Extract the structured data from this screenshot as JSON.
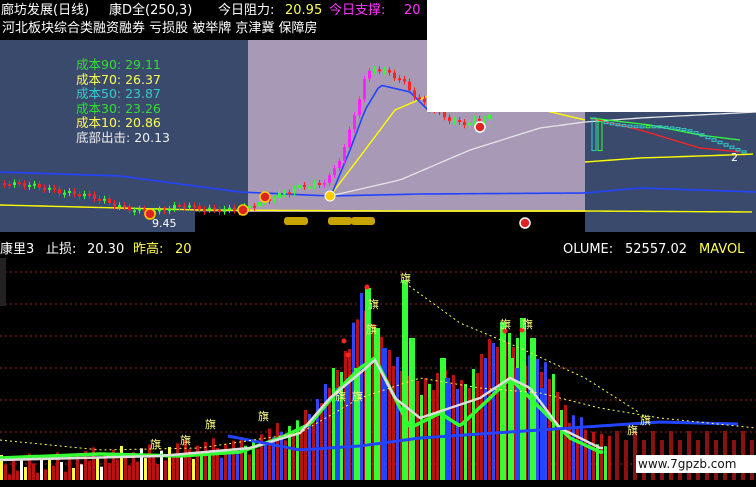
{
  "header": {
    "stock_name": "廊坊发展(日线)",
    "indicator": "康D全(250,3)",
    "resistance_label": "今日阻力:",
    "resistance_value": "20.95",
    "support_label": "今日支撑:",
    "support_value": "20"
  },
  "concepts": "河北板块综合类融资融券 亏损股 被举牌 京津冀 保障房",
  "cost_labels": [
    {
      "label": "成本90:",
      "value": "29.11",
      "color": "#33dd33"
    },
    {
      "label": "成本70:",
      "value": "26.37",
      "color": "#ffff55"
    },
    {
      "label": "成本50:",
      "value": "23.87",
      "color": "#33cccc"
    },
    {
      "label": "成本30:",
      "value": "23.26",
      "color": "#33dd33"
    },
    {
      "label": "成本10:",
      "value": "20.86",
      "color": "#ffff55"
    },
    {
      "label": "底部出击:",
      "value": "20.13",
      "color": "#eeeeee"
    }
  ],
  "annotations": {
    "low_price": "9.45",
    "right_marker": "2",
    "signal_char": "旗"
  },
  "lower_header": {
    "indicator": "康里3",
    "stop_label": "止损:",
    "stop_value": "20.30",
    "prev_high_label": "昨高:",
    "prev_high_value": "20",
    "volume_label": "OLUME:",
    "volume_value": "52557.02",
    "mavol_label": "MAVOL"
  },
  "watermark": "www.7gpzb.com",
  "colors": {
    "up": "#ff2222",
    "green": "#33ff33",
    "blue": "#2244ff",
    "magenta": "#ff22ff",
    "yellow": "#ffff00",
    "white": "#ffffff",
    "dark_red": "#990000",
    "shade": "#a899b6",
    "panel": "#3a4a6c"
  },
  "chart_data": [
    {
      "type": "line",
      "title": "廊坊发展(日线)",
      "series": [
        {
          "name": "成本90",
          "values": [
            29.11
          ]
        },
        {
          "name": "成本70",
          "values": [
            26.37
          ]
        },
        {
          "name": "成本50",
          "values": [
            23.87
          ]
        },
        {
          "name": "成本30",
          "values": [
            23.26
          ]
        },
        {
          "name": "成本10",
          "values": [
            20.86
          ]
        },
        {
          "name": "底部出击",
          "values": [
            20.13
          ]
        }
      ]
    },
    {
      "type": "bar",
      "title": "康里3",
      "series": [
        {
          "name": "VOLUME",
          "values": [
            52557.02
          ]
        }
      ]
    }
  ]
}
